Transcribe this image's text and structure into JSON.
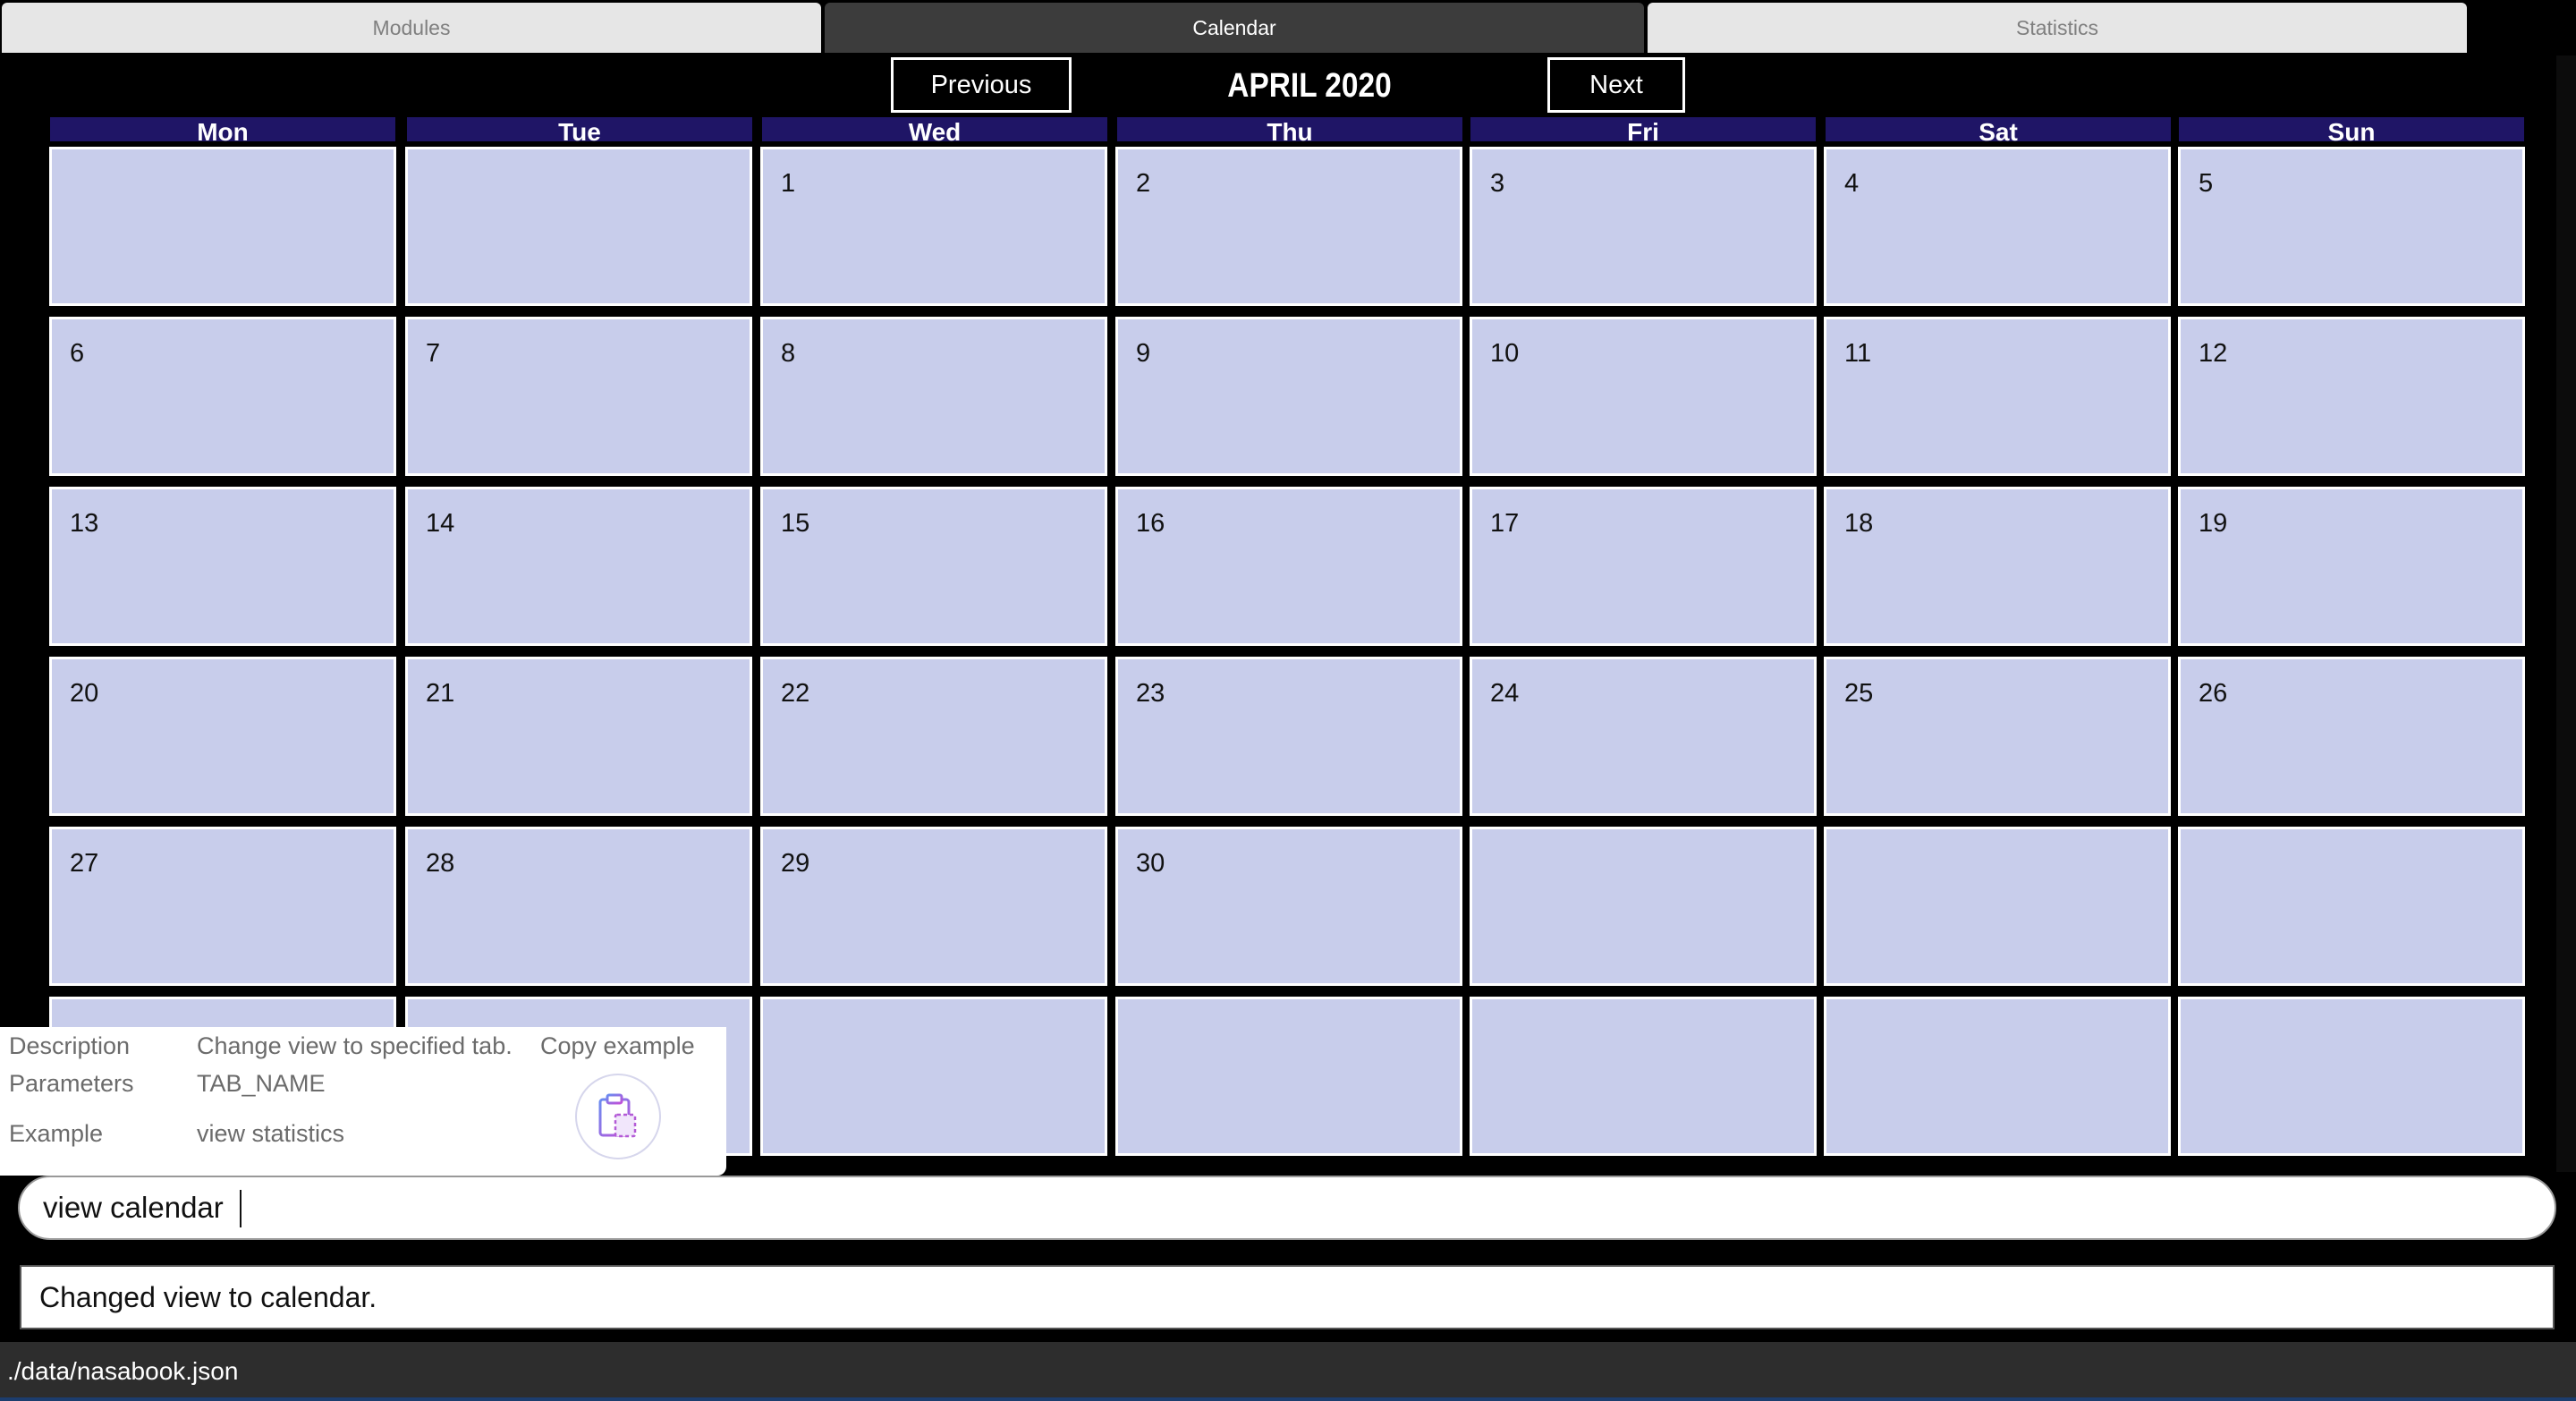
{
  "tabs": [
    {
      "label": "Modules",
      "active": false
    },
    {
      "label": "Calendar",
      "active": true
    },
    {
      "label": "Statistics",
      "active": false
    }
  ],
  "calendar": {
    "previous_label": "Previous",
    "next_label": "Next",
    "month_title": "APRIL 2020",
    "weekdays": [
      "Mon",
      "Tue",
      "Wed",
      "Thu",
      "Fri",
      "Sat",
      "Sun"
    ],
    "weeks": [
      [
        "",
        "",
        "1",
        "2",
        "3",
        "4",
        "5"
      ],
      [
        "6",
        "7",
        "8",
        "9",
        "10",
        "11",
        "12"
      ],
      [
        "13",
        "14",
        "15",
        "16",
        "17",
        "18",
        "19"
      ],
      [
        "20",
        "21",
        "22",
        "23",
        "24",
        "25",
        "26"
      ],
      [
        "27",
        "28",
        "29",
        "30",
        "",
        "",
        ""
      ],
      [
        "",
        "",
        "",
        "",
        "",
        "",
        ""
      ]
    ]
  },
  "help_popup": {
    "description_label": "Description",
    "description_value": "Change view to specified tab.",
    "parameters_label": "Parameters",
    "parameters_value": "TAB_NAME",
    "example_label": "Example",
    "example_value": "view statistics",
    "copy_label": "Copy example",
    "copy_icon": "clipboard-copy-icon"
  },
  "command": {
    "value": "view calendar"
  },
  "result": {
    "text": "Changed view to calendar."
  },
  "status": {
    "file_path": "./data/nasabook.json"
  },
  "colors": {
    "weekday_header": "#1f1566",
    "cell_fill": "#c8cdeb",
    "active_tab": "#3c3c3c",
    "inactive_tab": "#e6e6e6"
  }
}
